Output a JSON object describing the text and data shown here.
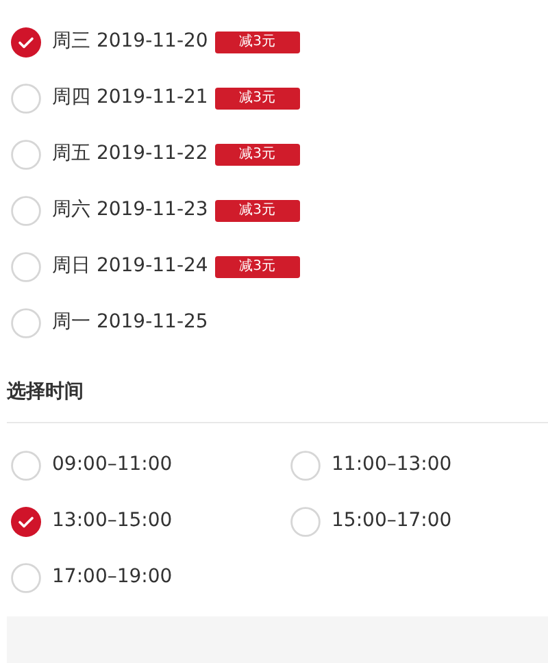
{
  "dates": [
    {
      "weekday": "周三",
      "date": "2019-11-20",
      "badge": "减3元",
      "selected": true
    },
    {
      "weekday": "周四",
      "date": "2019-11-21",
      "badge": "减3元",
      "selected": false
    },
    {
      "weekday": "周五",
      "date": "2019-11-22",
      "badge": "减3元",
      "selected": false
    },
    {
      "weekday": "周六",
      "date": "2019-11-23",
      "badge": "减3元",
      "selected": false
    },
    {
      "weekday": "周日",
      "date": "2019-11-24",
      "badge": "减3元",
      "selected": false
    },
    {
      "weekday": "周一",
      "date": "2019-11-25",
      "selected": false
    }
  ],
  "time_section": {
    "title": "选择时间",
    "slots": [
      {
        "label": "09:00–11:00",
        "selected": false
      },
      {
        "label": "11:00–13:00",
        "selected": false
      },
      {
        "label": "13:00–15:00",
        "selected": true
      },
      {
        "label": "15:00–17:00",
        "selected": false
      },
      {
        "label": "17:00–19:00",
        "selected": false
      }
    ]
  }
}
